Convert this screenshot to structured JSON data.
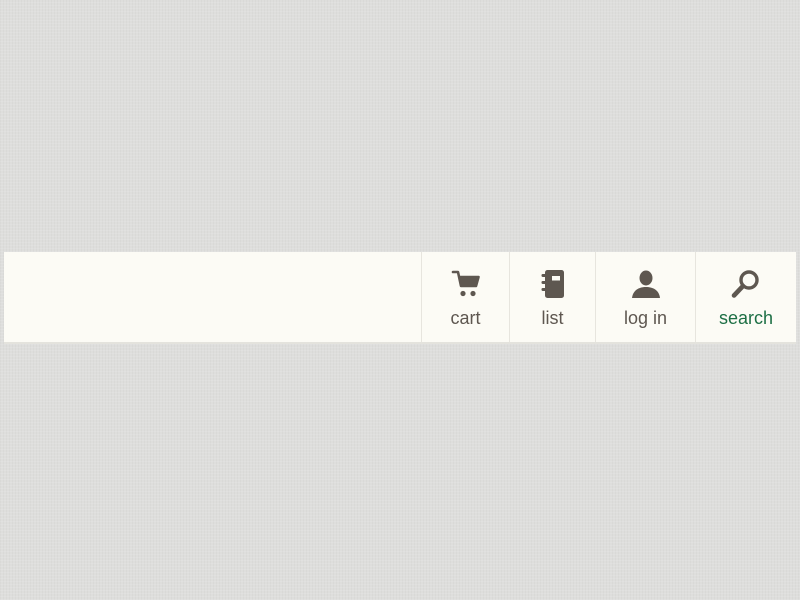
{
  "nav": {
    "items": [
      {
        "label": "cart",
        "icon": "cart-icon"
      },
      {
        "label": "list",
        "icon": "notebook-icon"
      },
      {
        "label": "log in",
        "icon": "user-icon"
      },
      {
        "label": "search",
        "icon": "search-icon",
        "active": true
      }
    ]
  },
  "colors": {
    "background": "#dededc",
    "bar": "#fcfbf5",
    "icon": "#5e5750",
    "label": "#5e5750",
    "active_label": "#1d6f45"
  }
}
